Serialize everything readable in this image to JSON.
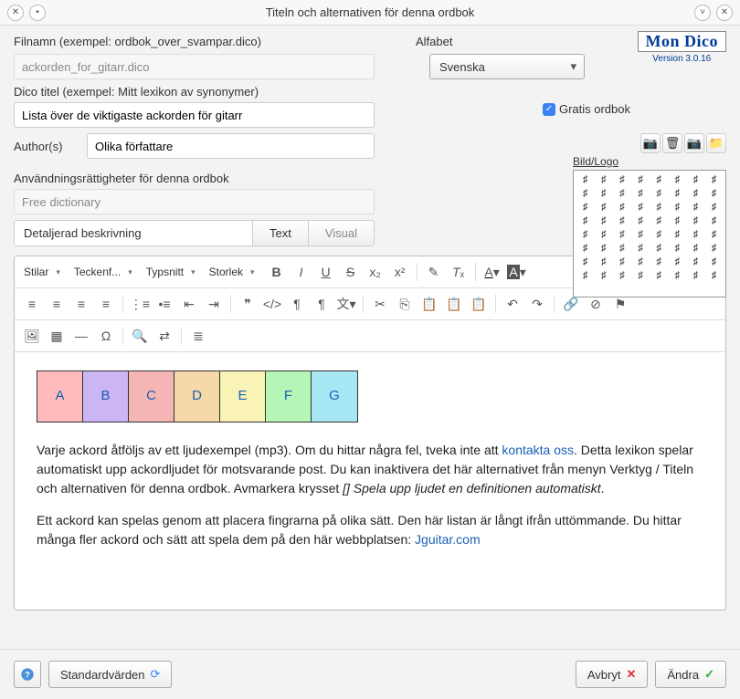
{
  "title": "Titeln och alternativen för denna ordbok",
  "brand": {
    "name": "Mon Dico",
    "version": "Version 3.0.16"
  },
  "labels": {
    "filename": "Filnamn (exempel: ordbok_over_svampar.dico)",
    "alphabet": "Alfabet",
    "dico_title": "Dico titel (exempel: Mitt lexikon av synonymer)",
    "authors": "Author(s)",
    "rights": "Användningsrättigheter för denna ordbok",
    "bild": "Bild/Logo",
    "detail": "Detaljerad beskrivning",
    "free_checkbox": "Gratis ordbok"
  },
  "fields": {
    "filename": "ackorden_for_gitarr.dico",
    "alphabet_selected": "Svenska",
    "dico_title": "Lista över de viktigaste ackorden för gitarr",
    "authors": "Olika författare",
    "rights": "Free dictionary"
  },
  "tabs": {
    "text": "Text",
    "visual": "Visual"
  },
  "editor_toolbar": {
    "styles": "Stilar",
    "font": "Teckenf...",
    "family": "Typsnitt",
    "size": "Storlek"
  },
  "chords": [
    "A",
    "B",
    "C",
    "D",
    "E",
    "F",
    "G"
  ],
  "body": {
    "p1a": "Varje ackord åtföljs av ett ljudexempel (mp3). Om du hittar några fel, tveka inte att ",
    "link1": "kontakta oss",
    "p1b": ". Detta lexikon spelar automatiskt upp ackordljudet för motsvarande post. Du kan inaktivera det här alternativet från menyn Verktyg / Titeln och alternativen för denna ordbok. Avmarkera krysset ",
    "em1": "[] Spela upp ljudet en definitionen automatiskt",
    "p1c": ".",
    "p2a": "Ett ackord kan spelas genom att placera fingrarna på olika sätt. Den här listan är långt ifrån uttömmande. Du hittar många fler ackord och sätt att spela dem på den här webbplatsen: ",
    "link2": "Jguitar.com"
  },
  "buttons": {
    "defaults": "Standardvärden",
    "cancel": "Avbryt",
    "apply": "Ändra"
  }
}
